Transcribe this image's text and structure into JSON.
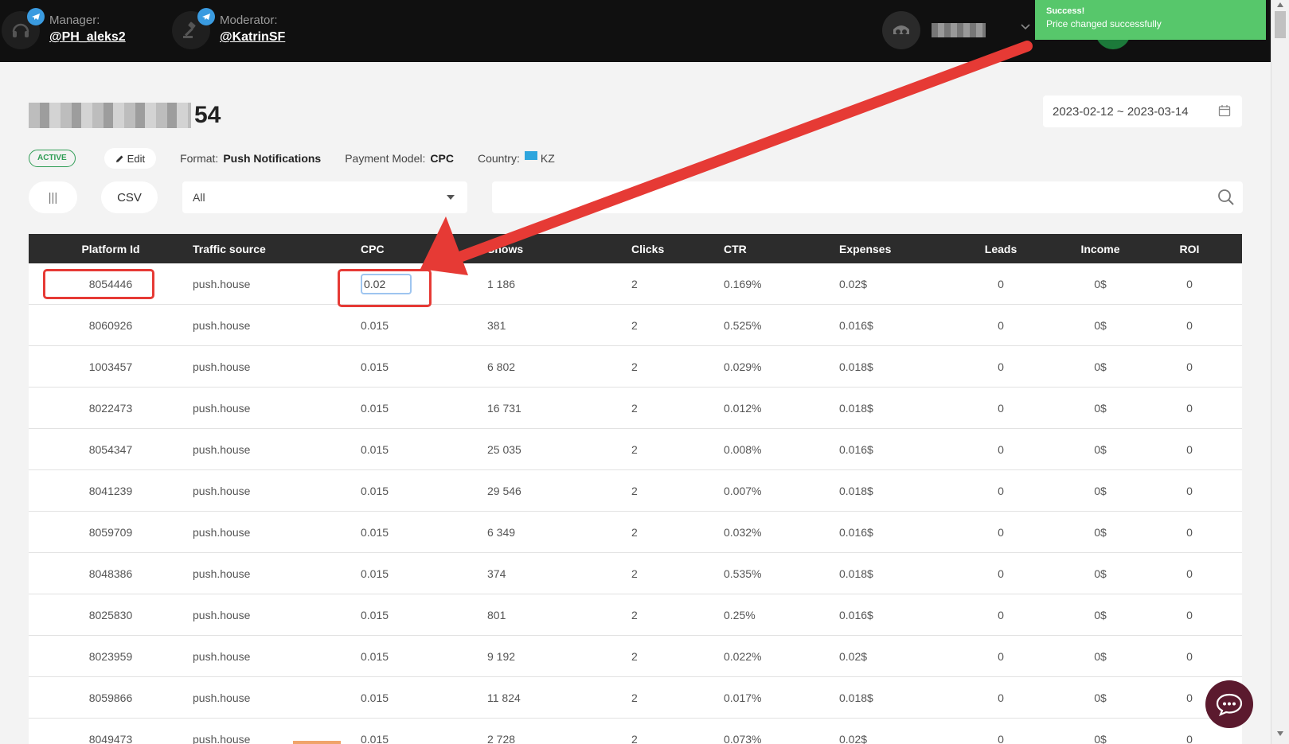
{
  "topbar": {
    "manager_role": "Manager:",
    "manager_handle": "@PH_aleks2",
    "moderator_role": "Moderator:",
    "moderator_handle": "@KatrinSF"
  },
  "toast": {
    "title": "Success!",
    "message": "Price changed successfully",
    "color": "#57c76b"
  },
  "campaign": {
    "title_suffix": "54",
    "status": "ACTIVE",
    "edit_label": "Edit",
    "format_label": "Format:",
    "format_value": "Push Notifications",
    "payment_label": "Payment Model:",
    "payment_value": "CPC",
    "country_label": "Country:",
    "country_value": "KZ",
    "date_range": "2023-02-12 ~ 2023-03-14"
  },
  "toolbar": {
    "columns_label": "|||",
    "csv_label": "CSV",
    "filter_value": "All"
  },
  "table": {
    "headers": [
      "Platform Id",
      "Traffic source",
      "CPC",
      "Shows",
      "Clicks",
      "CTR",
      "Expenses",
      "Leads",
      "Income",
      "ROI"
    ],
    "editing_cpc": "0.02",
    "rows": [
      [
        "8054446",
        "push.house",
        "0.02",
        "1 186",
        "2",
        "0.169%",
        "0.02$",
        "0",
        "0$",
        "0"
      ],
      [
        "8060926",
        "push.house",
        "0.015",
        "381",
        "2",
        "0.525%",
        "0.016$",
        "0",
        "0$",
        "0"
      ],
      [
        "1003457",
        "push.house",
        "0.015",
        "6 802",
        "2",
        "0.029%",
        "0.018$",
        "0",
        "0$",
        "0"
      ],
      [
        "8022473",
        "push.house",
        "0.015",
        "16 731",
        "2",
        "0.012%",
        "0.018$",
        "0",
        "0$",
        "0"
      ],
      [
        "8054347",
        "push.house",
        "0.015",
        "25 035",
        "2",
        "0.008%",
        "0.016$",
        "0",
        "0$",
        "0"
      ],
      [
        "8041239",
        "push.house",
        "0.015",
        "29 546",
        "2",
        "0.007%",
        "0.018$",
        "0",
        "0$",
        "0"
      ],
      [
        "8059709",
        "push.house",
        "0.015",
        "6 349",
        "2",
        "0.032%",
        "0.016$",
        "0",
        "0$",
        "0"
      ],
      [
        "8048386",
        "push.house",
        "0.015",
        "374",
        "2",
        "0.535%",
        "0.018$",
        "0",
        "0$",
        "0"
      ],
      [
        "8025830",
        "push.house",
        "0.015",
        "801",
        "2",
        "0.25%",
        "0.016$",
        "0",
        "0$",
        "0"
      ],
      [
        "8023959",
        "push.house",
        "0.015",
        "9 192",
        "2",
        "0.022%",
        "0.02$",
        "0",
        "0$",
        "0"
      ],
      [
        "8059866",
        "push.house",
        "0.015",
        "11 824",
        "2",
        "0.017%",
        "0.018$",
        "0",
        "0$",
        "0"
      ],
      [
        "8049473",
        "push.house",
        "0.015",
        "2 728",
        "2",
        "0.073%",
        "0.02$",
        "0",
        "0$",
        "0"
      ]
    ]
  },
  "colors": {
    "annotation_red": "#e63a35",
    "status_green": "#2f9d55",
    "header_dark": "#2c2c2c"
  }
}
